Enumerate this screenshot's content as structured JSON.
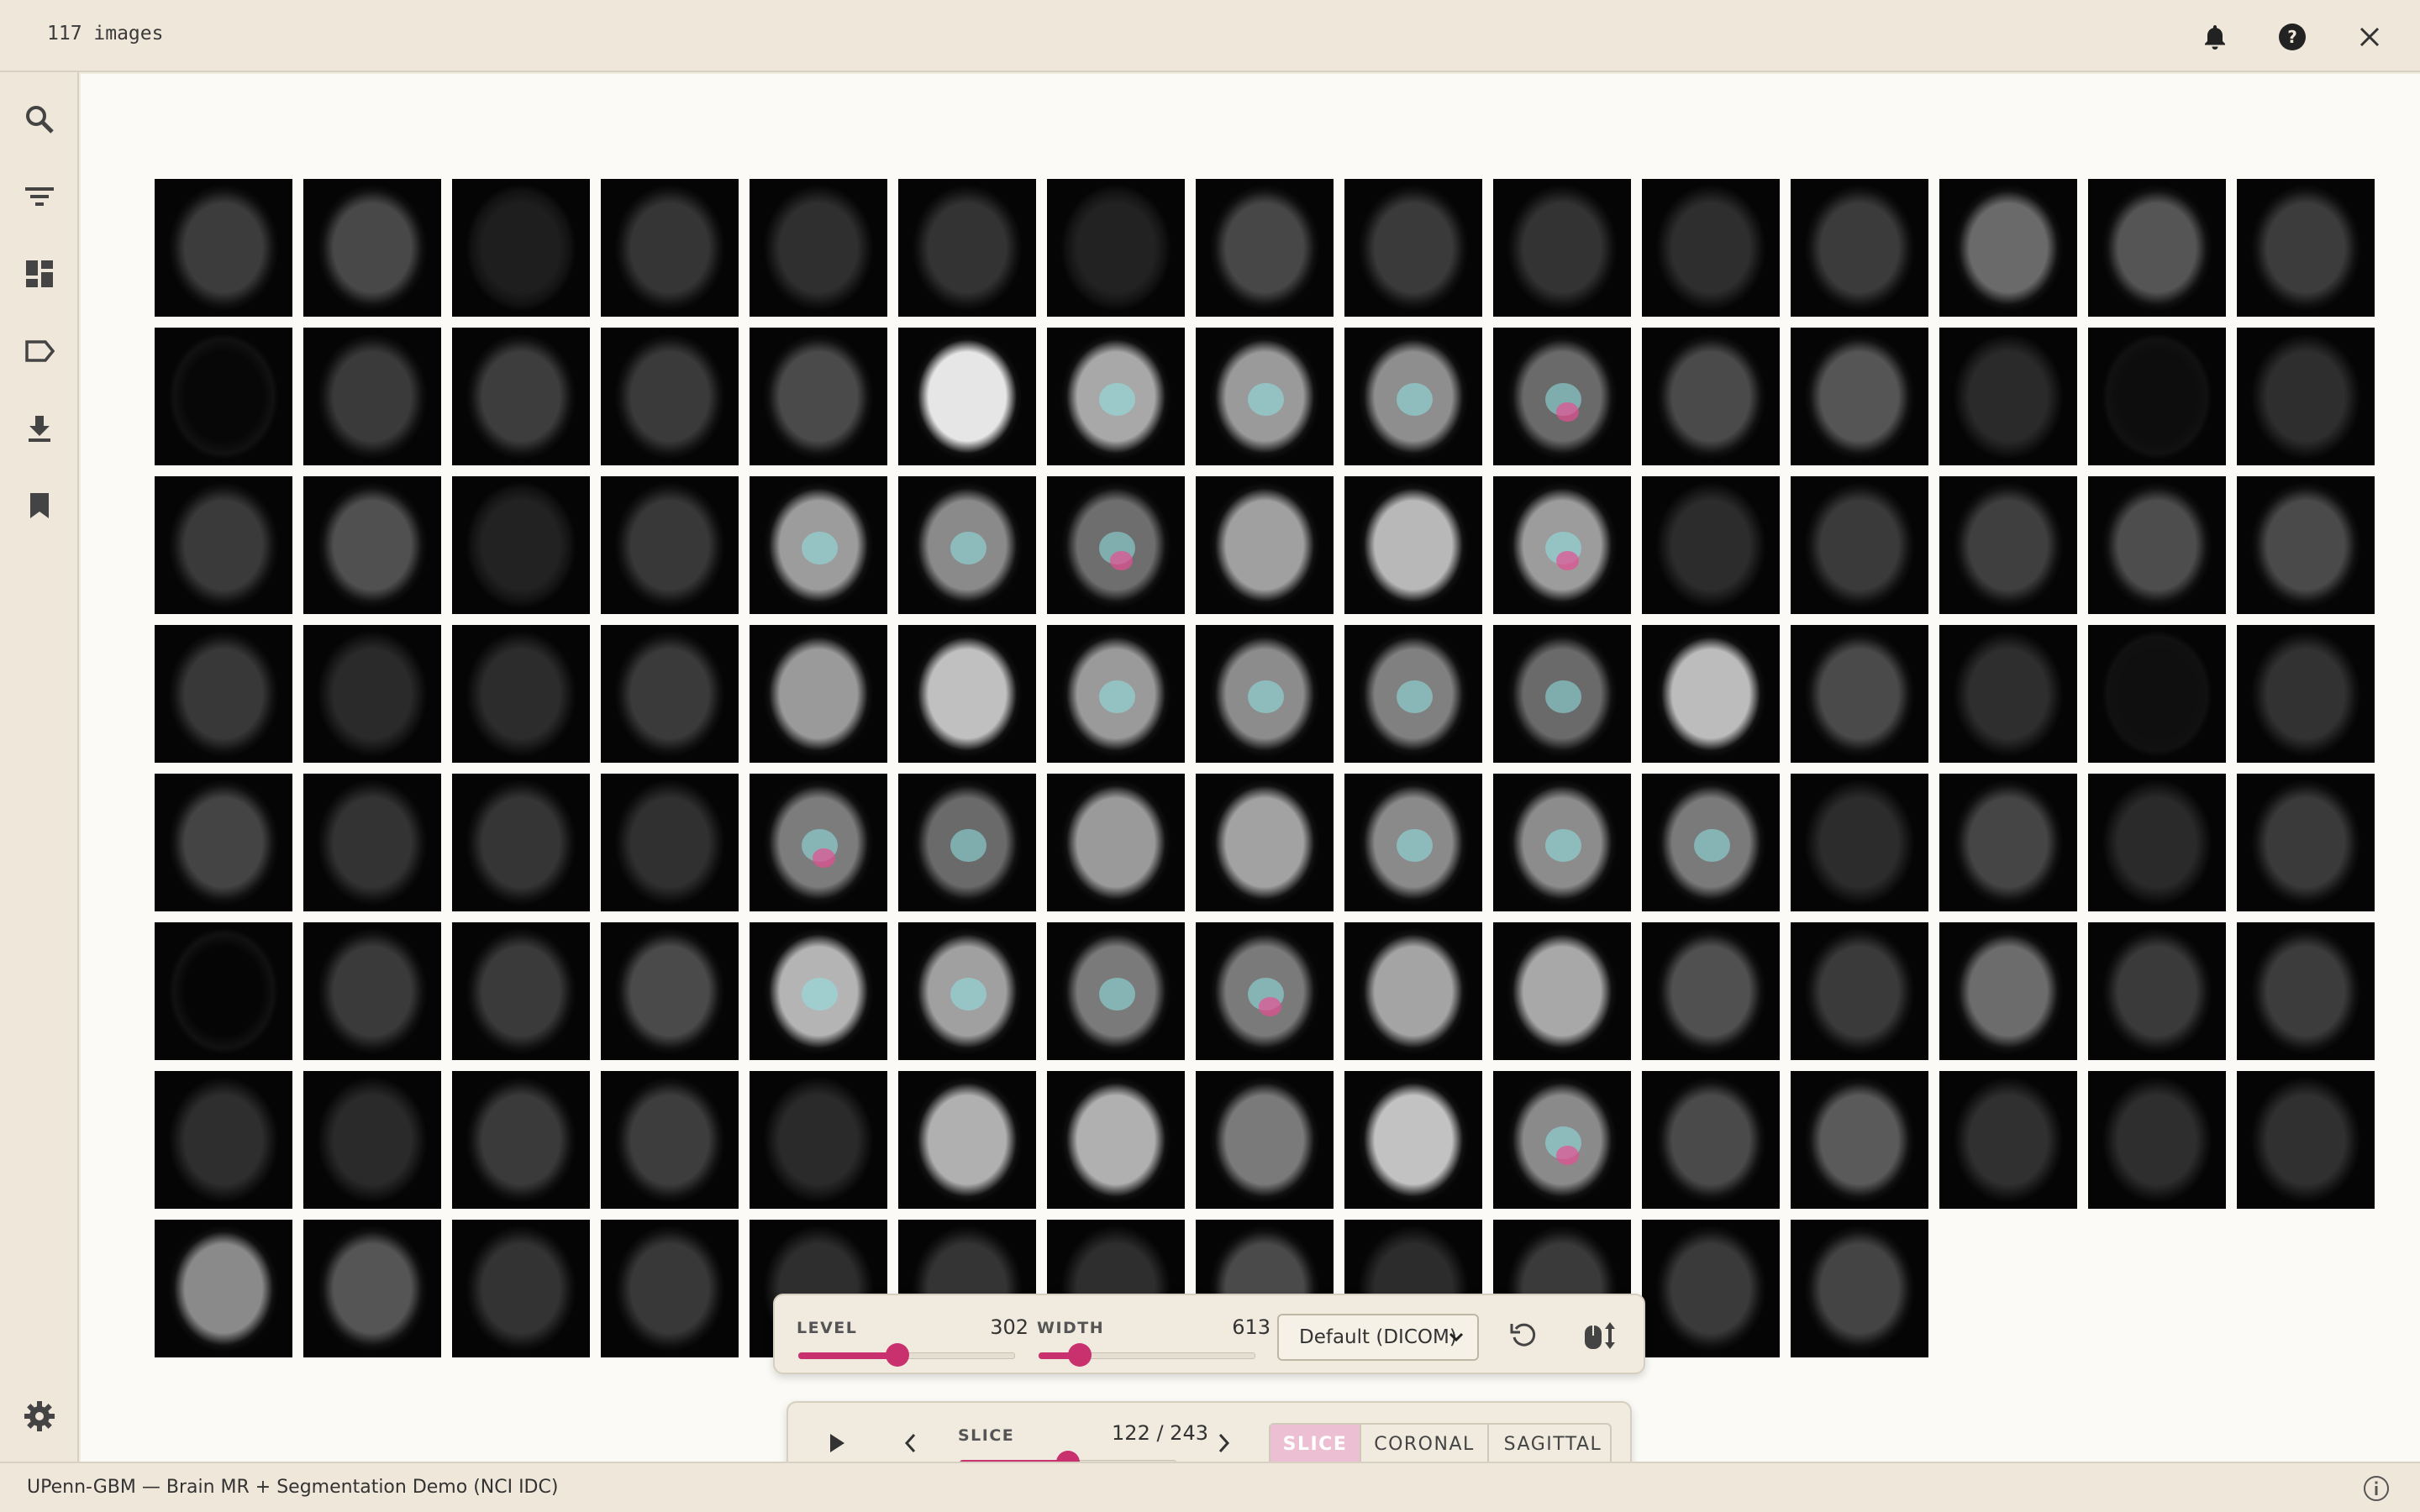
{
  "topbar": {
    "image_count": "117 images",
    "icons": [
      "bell-icon",
      "help-icon",
      "close-icon"
    ]
  },
  "sidebar": {
    "items": [
      {
        "icon": "search-icon"
      },
      {
        "icon": "filter-icon"
      },
      {
        "icon": "dashboard-icon"
      },
      {
        "icon": "label-icon"
      },
      {
        "icon": "download-icon"
      },
      {
        "icon": "bookmark-icon"
      }
    ],
    "settings_icon": "gear-icon"
  },
  "grid": {
    "rows": [
      [
        {
          "b": "#3c3c3c",
          "t": 0
        },
        {
          "b": "#484848",
          "t": 0
        },
        {
          "b": "#1e1e1e",
          "t": 0
        },
        {
          "b": "#353535",
          "t": 0
        },
        {
          "b": "#2f2f2f",
          "t": 0
        },
        {
          "b": "#333333",
          "t": 0
        },
        {
          "b": "#222222",
          "t": 0
        },
        {
          "b": "#474747",
          "t": 0
        },
        {
          "b": "#3a3a3a",
          "t": 0
        },
        {
          "b": "#333333",
          "t": 0
        },
        {
          "b": "#2e2e2e",
          "t": 0
        },
        {
          "b": "#3b3b3b",
          "t": 0
        },
        {
          "b": "#6a6a6a",
          "t": 0
        },
        {
          "b": "#555555",
          "t": 0
        },
        {
          "b": "#3c3c3c",
          "t": 0
        }
      ],
      [
        {
          "b": "#070707",
          "t": 0
        },
        {
          "b": "#3a3a3a",
          "t": 0
        },
        {
          "b": "#3d3d3d",
          "t": 0
        },
        {
          "b": "#3a3a3a",
          "t": 0
        },
        {
          "b": "#4a4a4a",
          "t": 0
        },
        {
          "b": "#e6e6e6",
          "t": 0
        },
        {
          "b": "#a8a8a8",
          "t": 1
        },
        {
          "b": "#9a9a9a",
          "t": 1
        },
        {
          "b": "#8e8e8e",
          "t": 1
        },
        {
          "b": "#6a6a6a",
          "t": 2
        },
        {
          "b": "#4a4a4a",
          "t": 0
        },
        {
          "b": "#555555",
          "t": 0
        },
        {
          "b": "#2a2a2a",
          "t": 0
        },
        {
          "b": "#0d0d0d",
          "t": 0
        },
        {
          "b": "#2e2e2e",
          "t": 0
        }
      ],
      [
        {
          "b": "#3a3a3a",
          "t": 0
        },
        {
          "b": "#505050",
          "t": 0
        },
        {
          "b": "#222222",
          "t": 0
        },
        {
          "b": "#383838",
          "t": 0
        },
        {
          "b": "#9c9c9c",
          "t": 1
        },
        {
          "b": "#8a8a8a",
          "t": 1
        },
        {
          "b": "#6e6e6e",
          "t": 2
        },
        {
          "b": "#a0a0a0",
          "t": 0
        },
        {
          "b": "#b8b8b8",
          "t": 0
        },
        {
          "b": "#9c9c9c",
          "t": 2
        },
        {
          "b": "#2c2c2c",
          "t": 0
        },
        {
          "b": "#3a3a3a",
          "t": 0
        },
        {
          "b": "#3f3f3f",
          "t": 0
        },
        {
          "b": "#4d4d4d",
          "t": 0
        },
        {
          "b": "#4a4a4a",
          "t": 0
        }
      ],
      [
        {
          "b": "#383838",
          "t": 0
        },
        {
          "b": "#2a2a2a",
          "t": 0
        },
        {
          "b": "#2c2c2c",
          "t": 0
        },
        {
          "b": "#3a3a3a",
          "t": 0
        },
        {
          "b": "#9a9a9a",
          "t": 0
        },
        {
          "b": "#c0c0c0",
          "t": 0
        },
        {
          "b": "#9a9a9a",
          "t": 1
        },
        {
          "b": "#8c8c8c",
          "t": 1
        },
        {
          "b": "#808080",
          "t": 1
        },
        {
          "b": "#6a6a6a",
          "t": 1
        },
        {
          "b": "#bcbcbc",
          "t": 0
        },
        {
          "b": "#4a4a4a",
          "t": 0
        },
        {
          "b": "#2e2e2e",
          "t": 0
        },
        {
          "b": "#0f0f0f",
          "t": 0
        },
        {
          "b": "#323232",
          "t": 0
        }
      ],
      [
        {
          "b": "#444444",
          "t": 0
        },
        {
          "b": "#333333",
          "t": 0
        },
        {
          "b": "#353535",
          "t": 0
        },
        {
          "b": "#303030",
          "t": 0
        },
        {
          "b": "#7c7c7c",
          "t": 2
        },
        {
          "b": "#6a6a6a",
          "t": 1
        },
        {
          "b": "#9a9a9a",
          "t": 0
        },
        {
          "b": "#a2a2a2",
          "t": 0
        },
        {
          "b": "#8a8a8a",
          "t": 1
        },
        {
          "b": "#8c8c8c",
          "t": 1
        },
        {
          "b": "#7a7a7a",
          "t": 1
        },
        {
          "b": "#2c2c2c",
          "t": 0
        },
        {
          "b": "#454545",
          "t": 0
        },
        {
          "b": "#2a2a2a",
          "t": 0
        },
        {
          "b": "#3a3a3a",
          "t": 0
        }
      ],
      [
        {
          "b": "#050505",
          "t": 0
        },
        {
          "b": "#3a3a3a",
          "t": 0
        },
        {
          "b": "#3a3a3a",
          "t": 0
        },
        {
          "b": "#4a4a4a",
          "t": 0
        },
        {
          "b": "#b4b4b4",
          "t": 1
        },
        {
          "b": "#a0a0a0",
          "t": 1
        },
        {
          "b": "#7a7a7a",
          "t": 1
        },
        {
          "b": "#7a7a7a",
          "t": 2
        },
        {
          "b": "#a4a4a4",
          "t": 0
        },
        {
          "b": "#a8a8a8",
          "t": 0
        },
        {
          "b": "#505050",
          "t": 0
        },
        {
          "b": "#3a3a3a",
          "t": 0
        },
        {
          "b": "#6c6c6c",
          "t": 0
        },
        {
          "b": "#3a3a3a",
          "t": 0
        },
        {
          "b": "#3c3c3c",
          "t": 0
        }
      ],
      [
        {
          "b": "#2e2e2e",
          "t": 0
        },
        {
          "b": "#2a2a2a",
          "t": 0
        },
        {
          "b": "#3a3a3a",
          "t": 0
        },
        {
          "b": "#3d3d3d",
          "t": 0
        },
        {
          "b": "#2a2a2a",
          "t": 0
        },
        {
          "b": "#b0b0b0",
          "t": 0
        },
        {
          "b": "#b0b0b0",
          "t": 0
        },
        {
          "b": "#7a7a7a",
          "t": 0
        },
        {
          "b": "#c2c2c2",
          "t": 0
        },
        {
          "b": "#8a8a8a",
          "t": 2
        },
        {
          "b": "#4a4a4a",
          "t": 0
        },
        {
          "b": "#5a5a5a",
          "t": 0
        },
        {
          "b": "#303030",
          "t": 0
        },
        {
          "b": "#2e2e2e",
          "t": 0
        },
        {
          "b": "#303030",
          "t": 0
        }
      ],
      [
        {
          "b": "#8a8a8a",
          "t": 0
        },
        {
          "b": "#555555",
          "t": 0
        },
        {
          "b": "#333333",
          "t": 0
        },
        {
          "b": "#383838",
          "t": 0
        },
        {
          "b": "#2e2e2e",
          "t": 0
        },
        {
          "b": "#343434",
          "t": 0
        },
        {
          "b": "#2e2e2e",
          "t": 0
        },
        {
          "b": "#4a4a4a",
          "t": 0
        },
        {
          "b": "#2c2c2c",
          "t": 0
        },
        {
          "b": "#3a3a3a",
          "t": 0
        },
        {
          "b": "#3a3a3a",
          "t": 0
        },
        {
          "b": "#444444",
          "t": 0
        }
      ]
    ]
  },
  "window_panel": {
    "level_label": "LEVEL",
    "level_value": "302",
    "level_fraction": 0.46,
    "width_label": "WIDTH",
    "width_value": "613",
    "width_fraction": 0.19,
    "preset": "Default (DICOM)",
    "reset_icon": "reset-icon",
    "mouse_icon": "mouse-adjust-icon"
  },
  "slice_panel": {
    "play_icon": "play-icon",
    "prev_icon": "chevron-left-icon",
    "next_icon": "chevron-right-icon",
    "slice_label": "SLICE",
    "slice_value": "122 / 243",
    "slice_fraction": 0.502,
    "views": [
      {
        "label": "SLICE",
        "active": true
      },
      {
        "label": "CORONAL",
        "active": false
      },
      {
        "label": "SAGITTAL",
        "active": false
      }
    ]
  },
  "status": {
    "dataset": "UPenn-GBM — Brain MR + Segmentation Demo (NCI IDC)",
    "info_icon": "info-icon"
  },
  "colors": {
    "accent": "#c8306e",
    "segment_active": "#ecc0d2",
    "background": "#f1ece0",
    "segmentation_cyan": "#8fe3e3",
    "segmentation_pink": "#e64f91"
  }
}
